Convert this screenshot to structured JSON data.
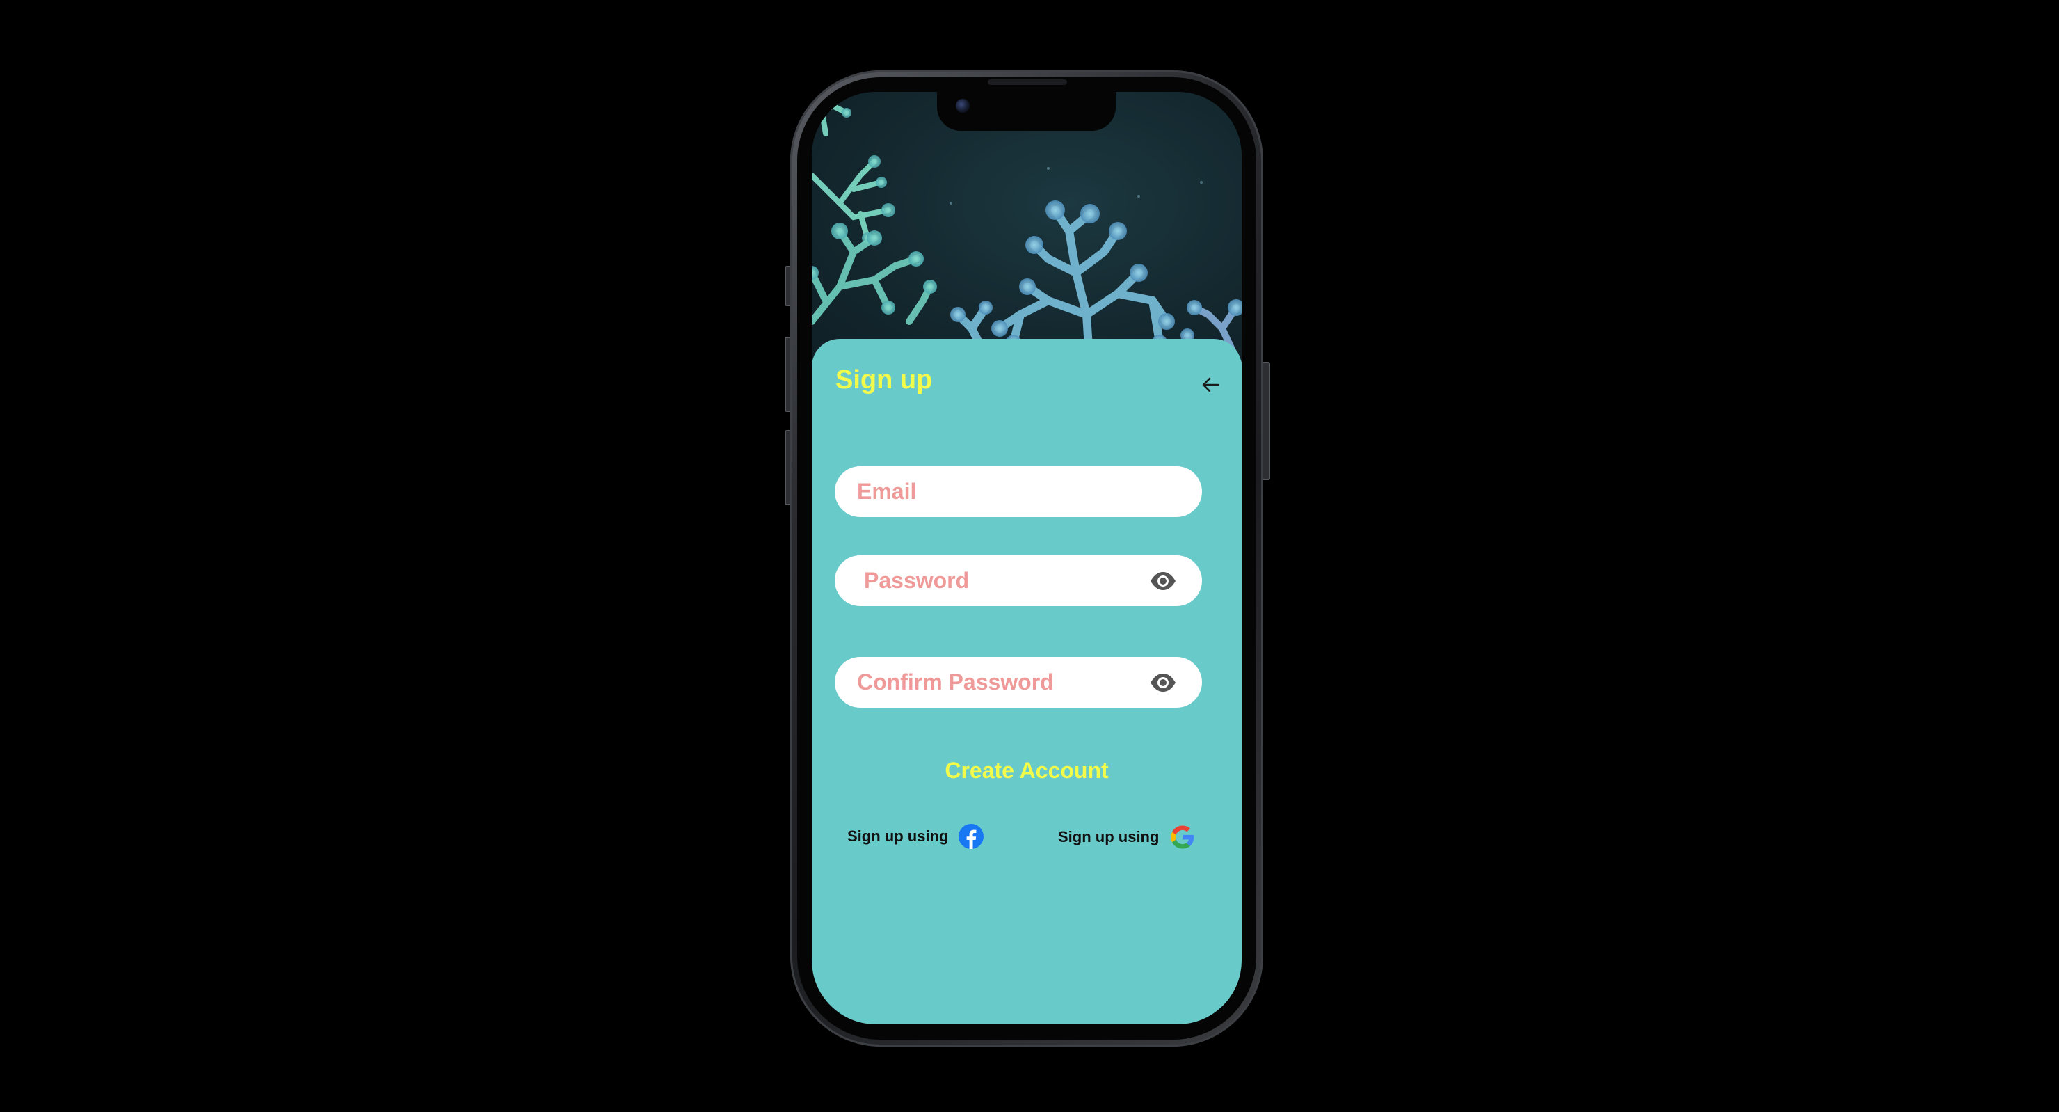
{
  "screen": {
    "title": "Sign up",
    "back_icon": "arrow-left-icon"
  },
  "form": {
    "email_placeholder": "Email",
    "password_placeholder": "Password",
    "confirm_password_placeholder": "Confirm Password",
    "visibility_icon": "eye-icon"
  },
  "actions": {
    "create_account_label": "Create Account"
  },
  "social": {
    "facebook_label": "Sign up using",
    "facebook_icon": "facebook-icon",
    "google_label": "Sign up using",
    "google_icon": "google-icon"
  },
  "colors": {
    "card_background": "#68cbca",
    "accent_yellow": "#f3fb4a",
    "placeholder_pink": "#ef9a98",
    "facebook_blue": "#1877f2"
  }
}
